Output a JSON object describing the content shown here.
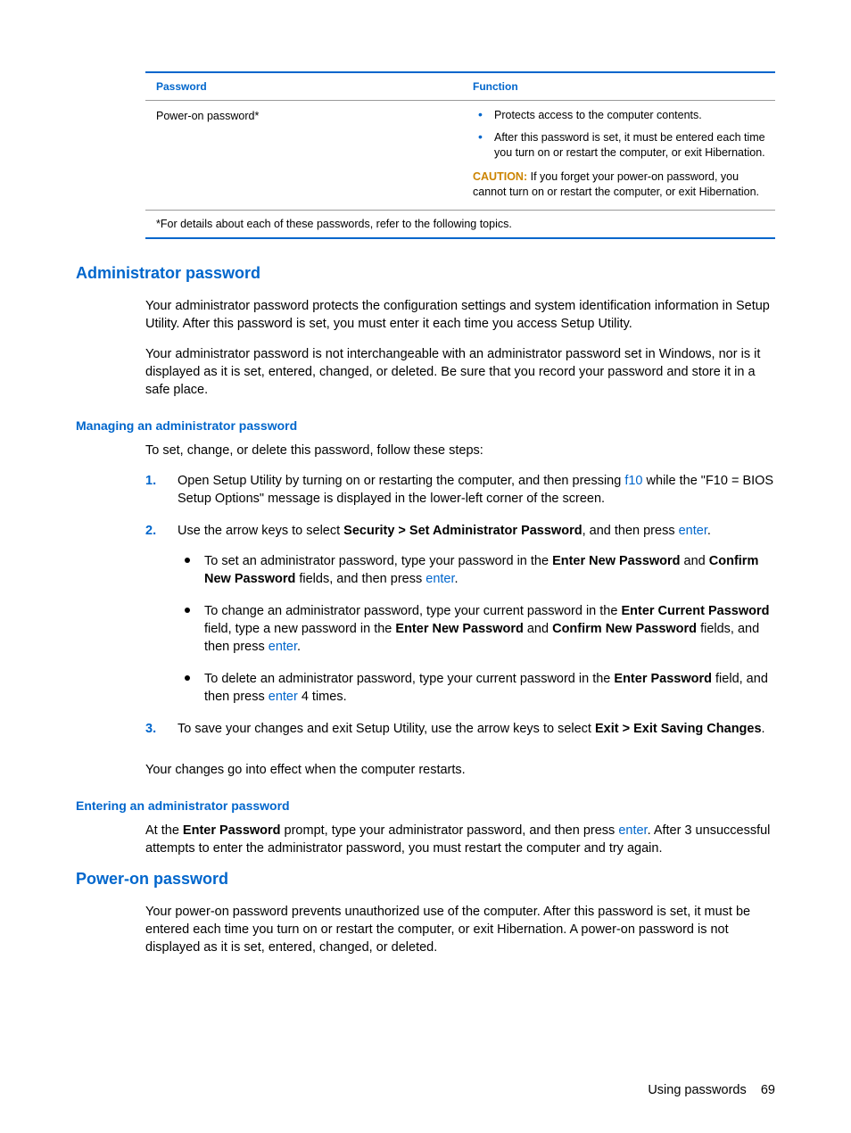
{
  "table": {
    "header_col1": "Password",
    "header_col2": "Function",
    "row1_col1": "Power-on password*",
    "func1": "Protects access to the computer contents.",
    "func2": "After this password is set, it must be entered each time you turn on or restart the computer, or exit Hibernation.",
    "caution_label": "CAUTION:",
    "caution_text": "If you forget your power-on password, you cannot turn on or restart the computer, or exit Hibernation.",
    "footnote": "*For details about each of these passwords, refer to the following topics."
  },
  "admin": {
    "heading": "Administrator password",
    "p1": "Your administrator password protects the configuration settings and system identification information in Setup Utility. After this password is set, you must enter it each time you access Setup Utility.",
    "p2": "Your administrator password is not interchangeable with an administrator password set in Windows, nor is it displayed as it is set, entered, changed, or deleted. Be sure that you record your password and store it in a safe place."
  },
  "managing": {
    "heading": "Managing an administrator password",
    "intro": "To set, change, or delete this password, follow these steps:",
    "step1_a": "Open Setup Utility by turning on or restarting the computer, and then pressing ",
    "step1_key": "f10",
    "step1_b": " while the \"F10 = BIOS Setup Options\" message is displayed in the lower-left corner of the screen.",
    "step2_a": "Use the arrow keys to select ",
    "step2_bold": "Security > Set Administrator Password",
    "step2_b": ", and then press ",
    "step2_key": "enter",
    "step2_c": ".",
    "sub1_a": "To set an administrator password, type your password in the ",
    "sub1_b1": "Enter New Password",
    "sub1_mid": " and ",
    "sub1_b2": "Confirm New Password",
    "sub1_c": " fields, and then press ",
    "sub1_key": "enter",
    "sub1_d": ".",
    "sub2_a": "To change an administrator password, type your current password in the ",
    "sub2_b1": "Enter Current Password",
    "sub2_mid1": " field, type a new password in the ",
    "sub2_b2": "Enter New Password",
    "sub2_mid2": " and ",
    "sub2_b3": "Confirm New Password",
    "sub2_c": " fields, and then press ",
    "sub2_key": "enter",
    "sub2_d": ".",
    "sub3_a": "To delete an administrator password, type your current password in the ",
    "sub3_b1": "Enter Password",
    "sub3_c": " field, and then press ",
    "sub3_key": "enter",
    "sub3_d": " 4 times.",
    "step3_a": "To save your changes and exit Setup Utility, use the arrow keys to select ",
    "step3_bold": "Exit > Exit Saving Changes",
    "step3_b": ".",
    "outro": "Your changes go into effect when the computer restarts."
  },
  "entering": {
    "heading": "Entering an administrator password",
    "p_a": "At the ",
    "p_b1": "Enter Password",
    "p_b": " prompt, type your administrator password, and then press ",
    "p_key": "enter",
    "p_c": ". After 3 unsuccessful attempts to enter the administrator password, you must restart the computer and try again."
  },
  "poweron": {
    "heading": "Power-on password",
    "p1": "Your power-on password prevents unauthorized use of the computer. After this password is set, it must be entered each time you turn on or restart the computer, or exit Hibernation. A power-on password is not displayed as it is set, entered, changed, or deleted."
  },
  "footer": {
    "section": "Using passwords",
    "page": "69"
  }
}
